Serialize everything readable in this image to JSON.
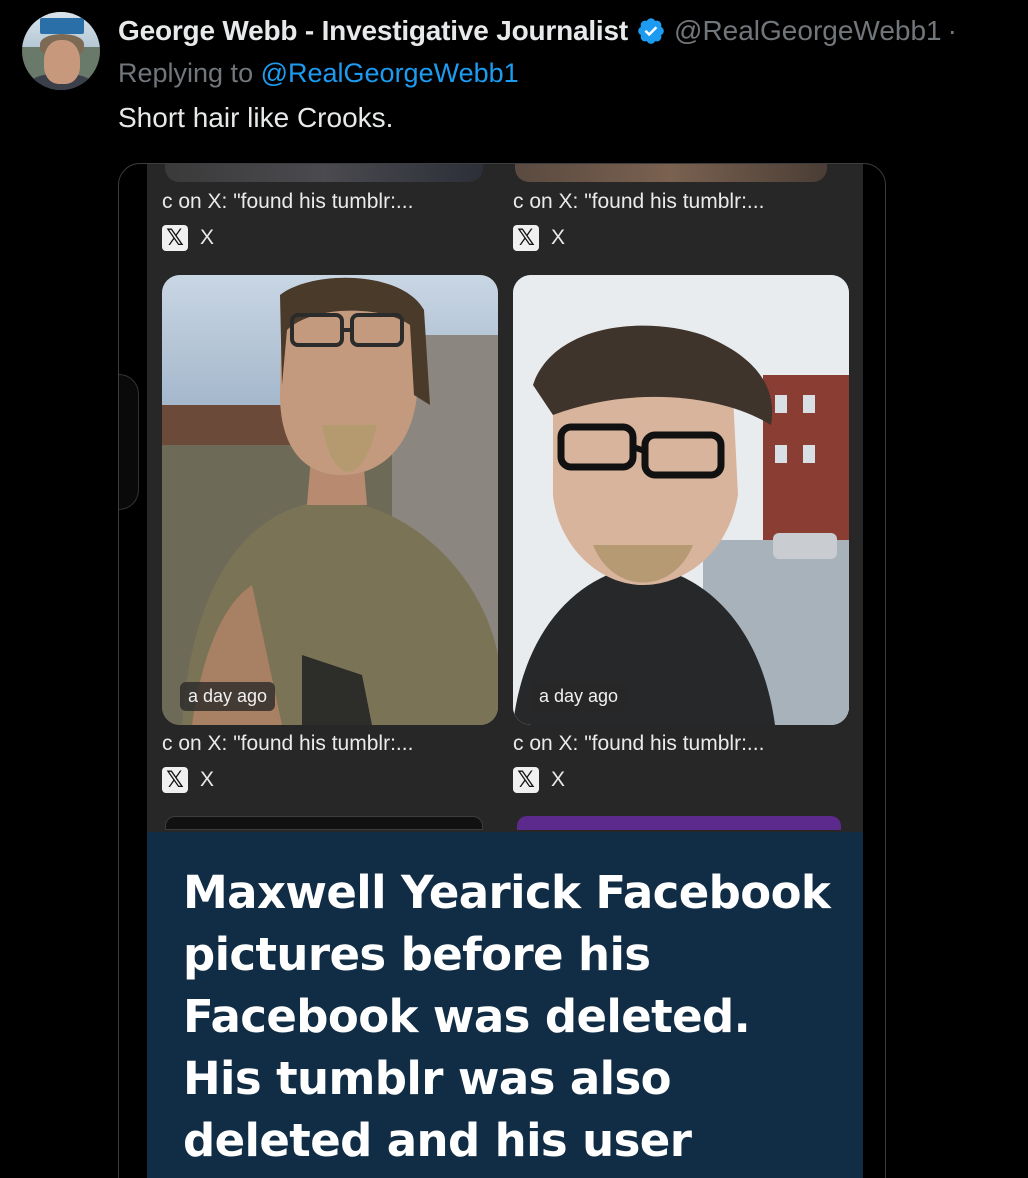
{
  "tweet": {
    "author_name": "George Webb - Investigative Journalist",
    "handle": "@RealGeorgeWebb1",
    "separator": "·",
    "reply_prefix": "Replying to ",
    "reply_mention": "@RealGeorgeWebb1",
    "text": "Short hair like Crooks."
  },
  "colors": {
    "background": "#000000",
    "link": "#1d9bf0",
    "verified": "#1d9bf0",
    "muted": "#71767b",
    "caption_panel": "#112d45"
  },
  "media": {
    "cards": [
      {
        "title": "c on X: \"found his tumblr:...",
        "source": "X"
      },
      {
        "title": "c on X: \"found his tumblr:...",
        "source": "X"
      },
      {
        "title": "c on X: \"found his tumblr:...",
        "source": "X",
        "timestamp": "a day ago"
      },
      {
        "title": "c on X: \"found his tumblr:...",
        "source": "X",
        "timestamp": "a day ago"
      }
    ],
    "x_logo_glyph": "𝕏",
    "caption": "Maxwell Yearick Facebook pictures before his Facebook was deleted. His tumblr was also deleted and his user name matches the same"
  },
  "icons": {
    "verified": "verified-badge-icon",
    "x_logo": "x-logo-icon"
  }
}
